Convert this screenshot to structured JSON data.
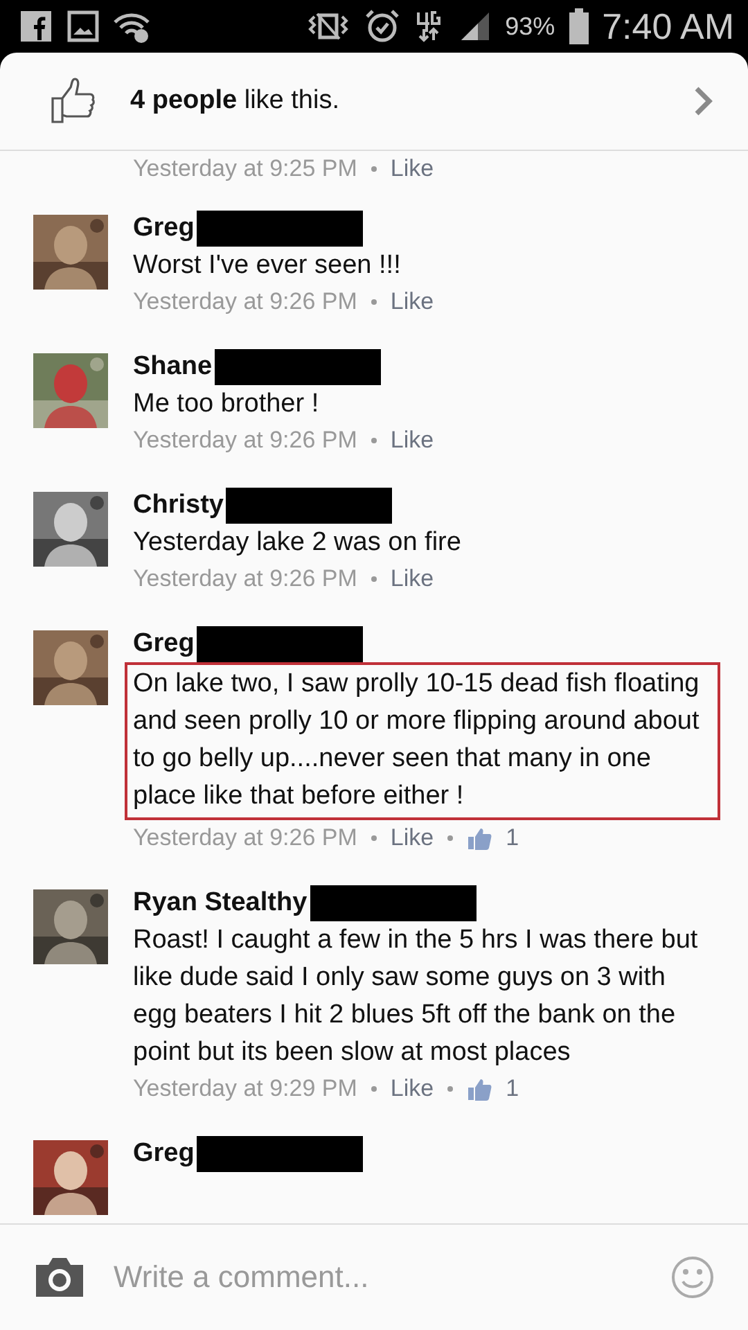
{
  "status_bar": {
    "battery": "93%",
    "time": "7:40 AM"
  },
  "likes_header": {
    "text": "**4 people** like this."
  },
  "comments": [
    {
      "kind": "meta_only",
      "time": "Yesterday at 9:25 PM",
      "action": "Like"
    },
    {
      "kind": "full",
      "name": "Greg",
      "redacted": true,
      "text": "Worst I've ever seen !!!",
      "time": "Yesterday at 9:26 PM",
      "action": "Like",
      "highlighted": false
    },
    {
      "kind": "full",
      "name": "Shane",
      "redacted": true,
      "text": "Me too brother !",
      "time": "Yesterday at 9:26 PM",
      "action": "Like",
      "highlighted": false
    },
    {
      "kind": "full",
      "name": "Christy",
      "redacted": true,
      "text": "Yesterday lake 2 was on fire",
      "time": "Yesterday at 9:26 PM",
      "action": "Like",
      "highlighted": false
    },
    {
      "kind": "full",
      "name": "Greg",
      "redacted": true,
      "text": "On lake two, I saw prolly 10-15 dead fish floating and seen prolly 10 or more flipping around about to go belly up....never seen that many in one place like that before either !",
      "time": "Yesterday at 9:26 PM",
      "action": "Like",
      "like_count": "1",
      "highlighted": true
    },
    {
      "kind": "full",
      "name": "Ryan Stealthy",
      "redacted": true,
      "text": "Roast! I caught a few in the 5 hrs I was there but like dude said I only saw some guys on 3 with egg beaters I hit 2 blues 5ft off the bank on the point but its been slow at most places",
      "time": "Yesterday at 9:29 PM",
      "action": "Like",
      "like_count": "1",
      "highlighted": false
    },
    {
      "kind": "name_only",
      "name": "Greg",
      "redacted": true
    }
  ],
  "composer": {
    "placeholder": "Write a comment..."
  }
}
